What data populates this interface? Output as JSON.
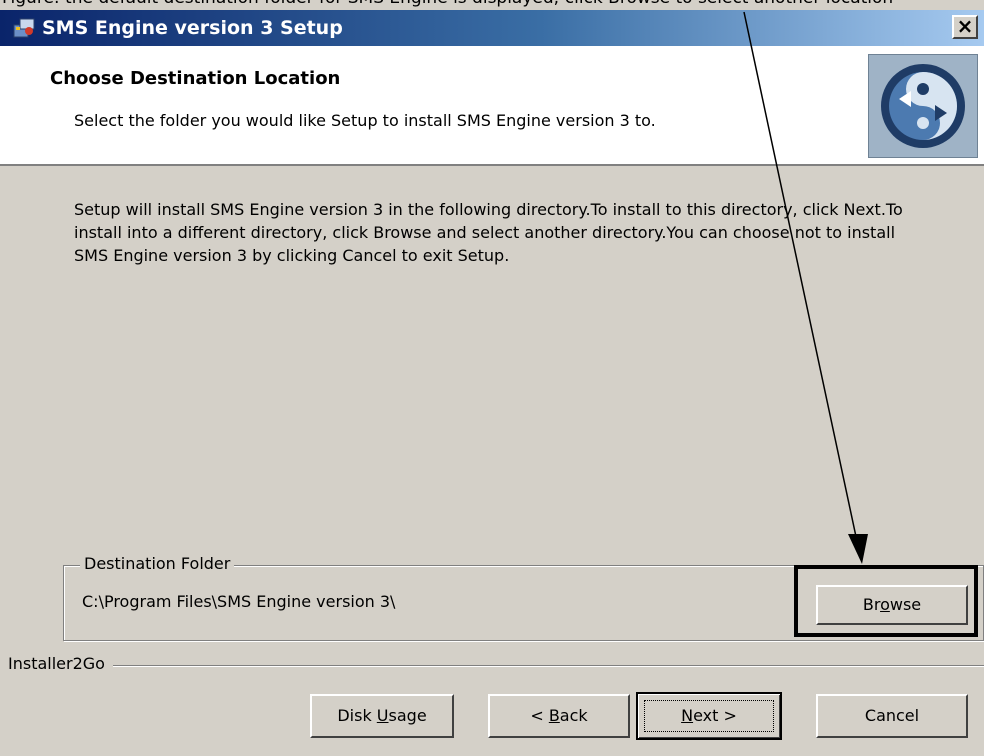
{
  "caption": "Figure: the default destination folder for SMS Engine is displayed; click Browse to select another location",
  "window": {
    "title": "SMS Engine version 3 Setup",
    "close_glyph": "×"
  },
  "header": {
    "title": "Choose Destination Location",
    "subtitle": "Select the folder you would like Setup to install SMS Engine version 3 to."
  },
  "body": {
    "text": "Setup will install SMS Engine version 3 in the following directory.To install to this directory, click Next.To install into a different directory, click Browse and select another directory.You can choose not to install SMS Engine version 3 by clicking Cancel to exit Setup."
  },
  "destination": {
    "legend": "Destination Folder",
    "path": "C:\\Program Files\\SMS Engine version 3\\",
    "browse_pre": "Br",
    "browse_u": "o",
    "browse_post": "wse"
  },
  "footer": {
    "brand": "Installer2Go",
    "disk_pre": "Disk ",
    "disk_u": "U",
    "disk_post": "sage",
    "back_pre": "< ",
    "back_u": "B",
    "back_post": "ack",
    "next_u": "N",
    "next_post": "ext >",
    "cancel": "Cancel"
  },
  "colors": {
    "title_start": "#0a246a",
    "title_end": "#a6caf0",
    "face": "#d4d0c8"
  }
}
